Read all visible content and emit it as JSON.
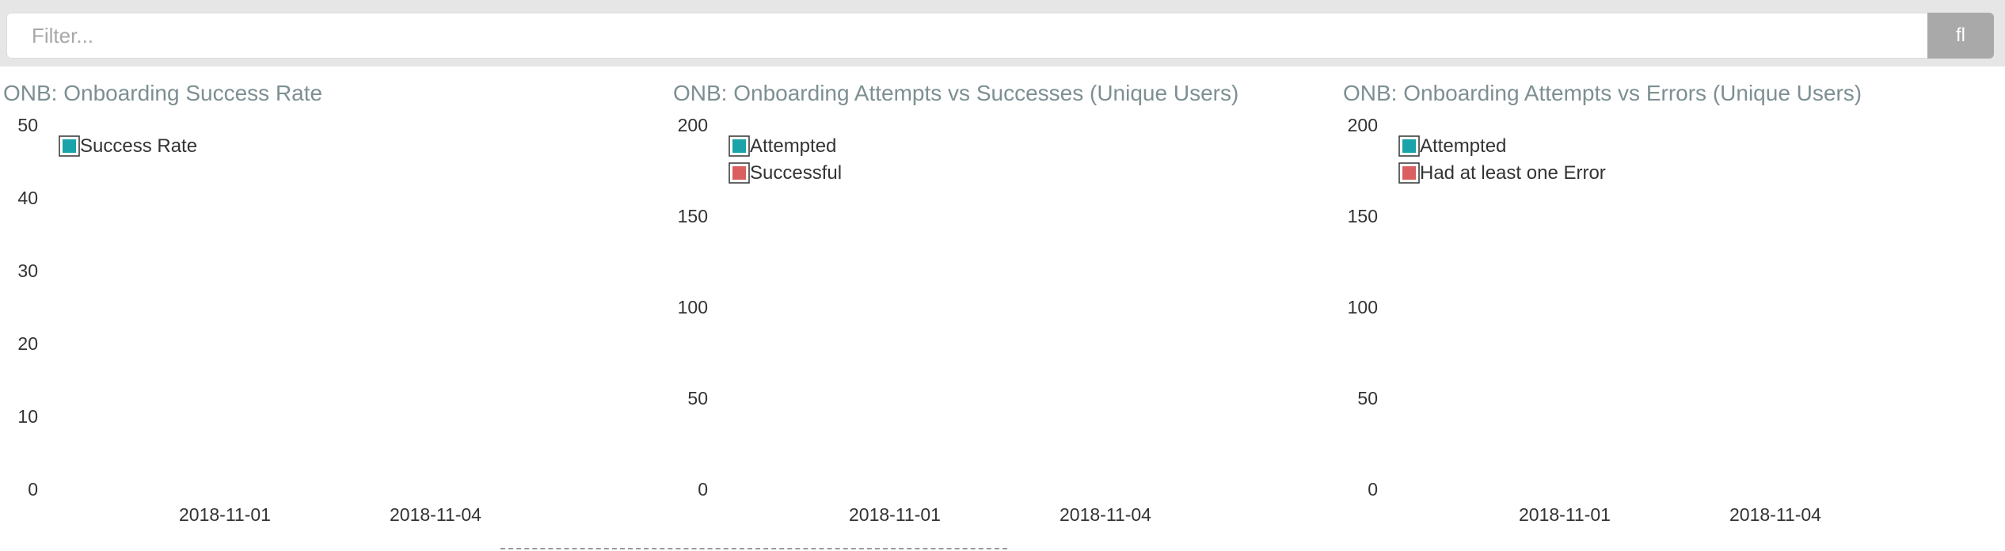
{
  "filter": {
    "placeholder": "Filter...",
    "button_glyph": "fl"
  },
  "colors": {
    "teal": "#1aa3a9",
    "red": "#d9605f",
    "title": "#7d8f92",
    "button": "#a9a9a9"
  },
  "chart_data": [
    {
      "type": "bar",
      "title": "ONB: Onboarding Success Rate",
      "y_ticks": [
        "0",
        "10",
        "20",
        "30",
        "40",
        "50"
      ],
      "ylim": [
        0,
        50
      ],
      "x_ticks": [
        "2018-11-01",
        "2018-11-04"
      ],
      "series": [
        {
          "name": "Success Rate",
          "color": "#1aa3a9",
          "values": []
        }
      ],
      "legend": "top-left",
      "grid": false
    },
    {
      "type": "bar",
      "title": "ONB: Onboarding Attempts vs Successes (Unique Users)",
      "y_ticks": [
        "0",
        "50",
        "100",
        "150",
        "200"
      ],
      "ylim": [
        0,
        200
      ],
      "x_ticks": [
        "2018-11-01",
        "2018-11-04"
      ],
      "series": [
        {
          "name": "Attempted",
          "color": "#1aa3a9",
          "values": []
        },
        {
          "name": "Successful",
          "color": "#d9605f",
          "values": []
        }
      ],
      "legend": "top-left",
      "grid": false
    },
    {
      "type": "bar",
      "title": "ONB: Onboarding Attempts vs Errors (Unique Users)",
      "y_ticks": [
        "0",
        "50",
        "100",
        "150",
        "200"
      ],
      "ylim": [
        0,
        200
      ],
      "x_ticks": [
        "2018-11-01",
        "2018-11-04"
      ],
      "series": [
        {
          "name": "Attempted",
          "color": "#1aa3a9",
          "values": []
        },
        {
          "name": "Had at least one Error",
          "color": "#d9605f",
          "values": []
        }
      ],
      "legend": "top-left",
      "grid": false
    }
  ]
}
